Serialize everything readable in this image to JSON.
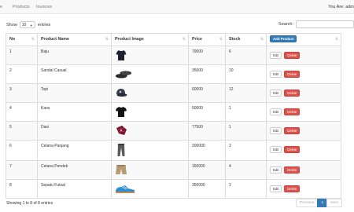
{
  "nav": {
    "brand_fragment": "e",
    "products": "Products",
    "invoices": "Invoices",
    "user": "You Are: adm"
  },
  "controls": {
    "show_label": "Show",
    "length_value": "10",
    "entries_label": "entries",
    "search_label": "Search:"
  },
  "table": {
    "headers": {
      "no": "No",
      "name": "Product Name",
      "image": "Product Image",
      "price": "Price",
      "stock": "Stock",
      "add_button": "Add Product"
    },
    "rows": [
      {
        "no": "1",
        "name": "Baju",
        "image_icon": "shirt-icon",
        "price": "79000",
        "stock": "6"
      },
      {
        "no": "2",
        "name": "Sandal Casual",
        "image_icon": "sandal-icon",
        "price": "35000",
        "stock": "10"
      },
      {
        "no": "3",
        "name": "Topi",
        "image_icon": "cap-icon",
        "price": "60000",
        "stock": "12"
      },
      {
        "no": "4",
        "name": "Kaos",
        "image_icon": "tshirt-icon",
        "price": "50000",
        "stock": "1"
      },
      {
        "no": "5",
        "name": "Dasi",
        "image_icon": "tie-icon",
        "price": "77500",
        "stock": "1"
      },
      {
        "no": "6",
        "name": "Celana Panjang",
        "image_icon": "trousers-icon",
        "price": "200000",
        "stock": "3"
      },
      {
        "no": "7",
        "name": "Celana Pendek",
        "image_icon": "shorts-icon",
        "price": "150000",
        "stock": "4"
      },
      {
        "no": "8",
        "name": "Sepatu Futsal",
        "image_icon": "shoe-icon",
        "price": "350000",
        "stock": "1"
      }
    ],
    "edit_label": "Edit",
    "delete_label": "Delete"
  },
  "footer": {
    "info": "Showing 1 to 8 of 8 entries",
    "previous": "Previous",
    "current_page": "1",
    "next": "Next"
  },
  "colors": {
    "primary": "#337ab7",
    "danger": "#d9534f",
    "navbar_bg": "#f8f8f8",
    "stripe": "#f9f9f9"
  }
}
